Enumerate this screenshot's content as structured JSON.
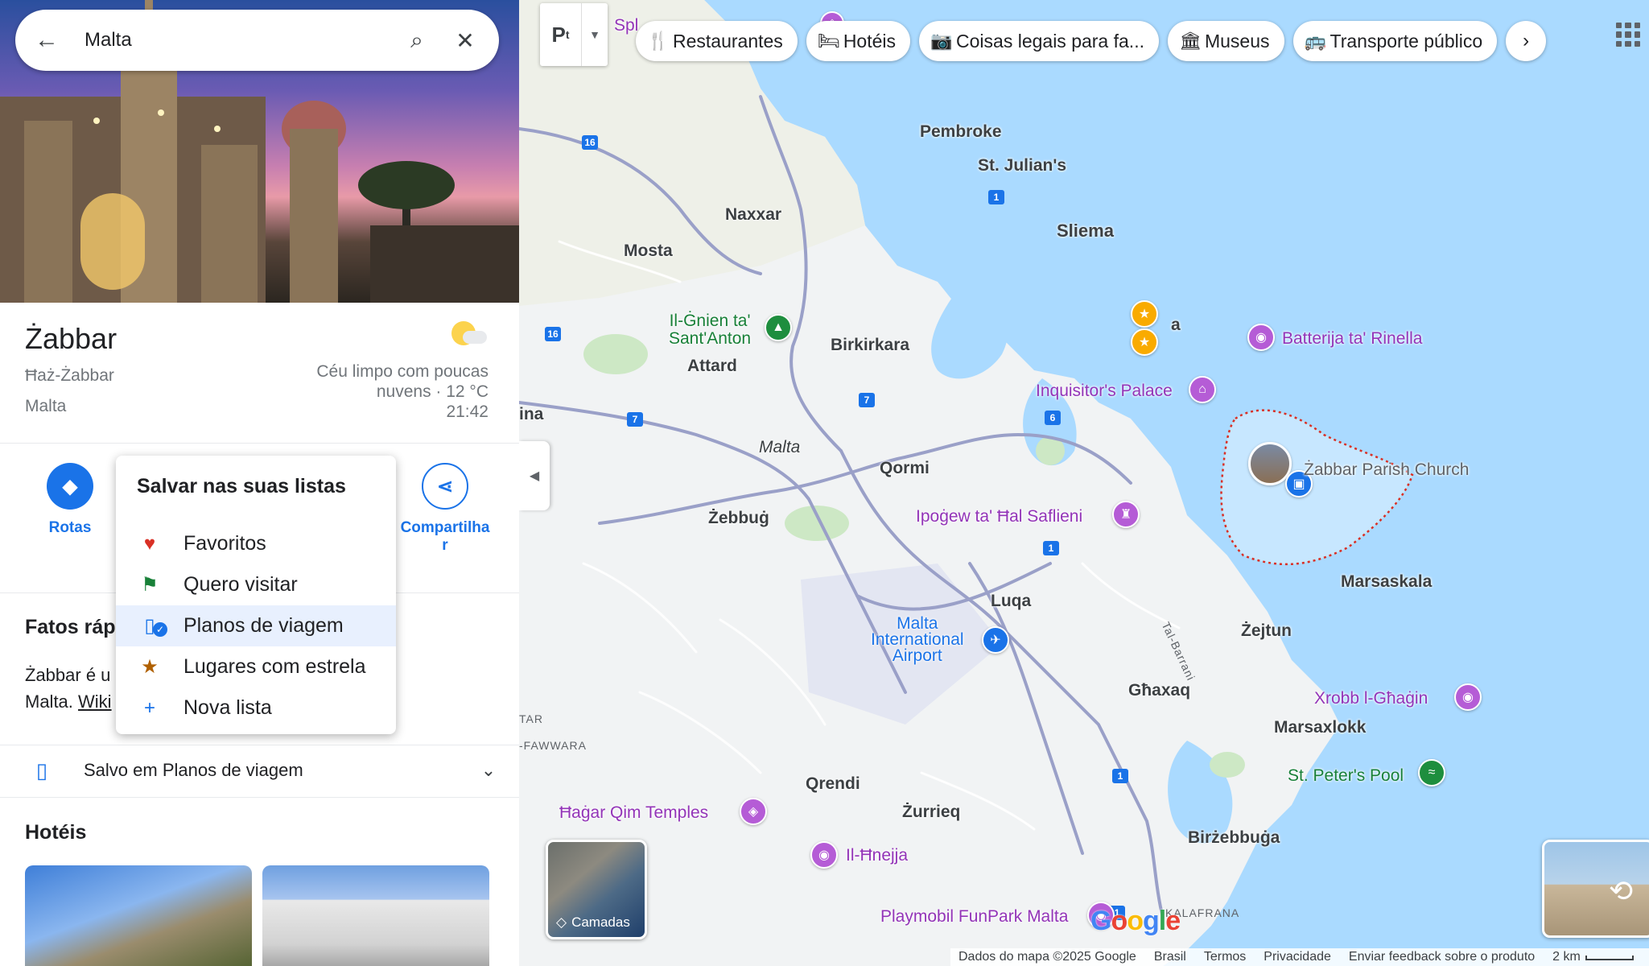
{
  "search": {
    "value": "Malta"
  },
  "place": {
    "title": "Żabbar",
    "subtitle": "Ħaż-Żabbar",
    "country": "Malta",
    "weather": {
      "line1": "Céu limpo com poucas",
      "line2": "nuvens · 12 °C",
      "time": "21:42"
    }
  },
  "actions": {
    "routes": "Rotas",
    "share_line1": "Compartilha",
    "share_line2": "r"
  },
  "save_menu": {
    "title": "Salvar nas suas listas",
    "items": [
      {
        "label": "Favoritos",
        "icon": "heart-icon",
        "color": "#d93025"
      },
      {
        "label": "Quero visitar",
        "icon": "flag-icon",
        "color": "#188038"
      },
      {
        "label": "Planos de viagem",
        "icon": "suitcase-icon",
        "color": "#1a73e8",
        "selected": true
      },
      {
        "label": "Lugares com estrela",
        "icon": "star-icon",
        "color": "#b06000"
      },
      {
        "label": "Nova lista",
        "icon": "plus-icon",
        "color": "#1a73e8"
      }
    ]
  },
  "facts": {
    "title_partial": "Fatos ráp",
    "line1": "Żabbar é u",
    "line2_text": "Malta. ",
    "line2_link": "Wiki"
  },
  "saved": {
    "label": "Salvo em Planos de viagem"
  },
  "hotels": {
    "title": "Hotéis"
  },
  "chips": [
    {
      "label": "Restaurantes",
      "icon": "fork-knife-icon"
    },
    {
      "label": "Hotéis",
      "icon": "bed-icon"
    },
    {
      "label": "Coisas legais para fa...",
      "icon": "camera-icon"
    },
    {
      "label": "Museus",
      "icon": "museum-icon"
    },
    {
      "label": "Transporte público",
      "icon": "bus-icon"
    }
  ],
  "map": {
    "towns": {
      "pembroke": "Pembroke",
      "stjulians": "St. Julian's",
      "naxxar": "Naxxar",
      "sliema": "Sliema",
      "mosta": "Mosta",
      "birkirkara": "Birkirkara",
      "attard": "Attard",
      "ina": "ina",
      "malta": "Malta",
      "qormi": "Qormi",
      "zebbug": "Żebbuġ",
      "luqa": "Luqa",
      "zejtun": "Żejtun",
      "marsaskala": "Marsaskala",
      "ghaxaq": "Għaxaq",
      "marsaxlokk": "Marsaxlokk",
      "qrendi": "Qrendi",
      "zurrieq": "Żurrieq",
      "birzebbuga": "Birżebbuġa",
      "a_partial": "a"
    },
    "pois": {
      "splash": "Spl",
      "ghnien1": "Il-Ġnien ta'",
      "ghnien2": "Sant'Anton",
      "rinella": "Batterija ta' Rinella",
      "inquisitor": "Inquisitor's Palace",
      "church": "Żabbar Parish Church",
      "hypogeum": "Ipoġew ta' Ħal Saflieni",
      "airport1": "Malta",
      "airport2": "International",
      "airport3": "Airport",
      "xrobb": "Xrobb l-Għaġin",
      "stpeters": "St. Peter's Pool",
      "hagarqim": "Ħaġar Qim Temples",
      "hnejja": "Il-Ħnejja",
      "playmobil": "Playmobil FunPark Malta"
    },
    "small": {
      "tar": "TAR",
      "fawwara": "-FAWWARA",
      "kalafrana": "KALAFRANA",
      "tal_barrani": "Tal-Barrani"
    },
    "shields": [
      "16",
      "16",
      "1",
      "7",
      "7",
      "6",
      "1",
      "1",
      "1"
    ]
  },
  "layers_label": "Camadas",
  "footer": {
    "data": "Dados do mapa ©2025 Google",
    "country": "Brasil",
    "terms": "Termos",
    "privacy": "Privacidade",
    "feedback": "Enviar feedback sobre o produto",
    "scale": "2 km"
  },
  "google_logo": "Google"
}
